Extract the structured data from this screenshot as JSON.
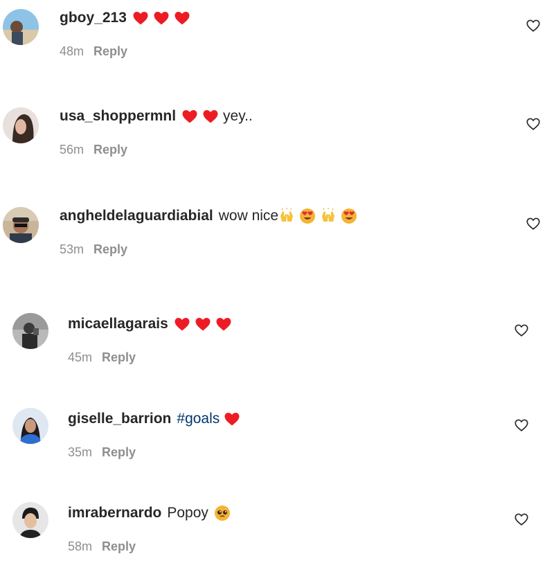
{
  "colors": {
    "heart": "#ed1c24",
    "text": "#262626",
    "muted": "#8e8e8e",
    "hashtag": "#00376b"
  },
  "comments": [
    {
      "username": "gboy_213",
      "text": "",
      "hashtag": "",
      "emojis": [
        "red-heart",
        "red-heart",
        "red-heart"
      ],
      "time": "48m",
      "reply": "Reply"
    },
    {
      "username": "usa_shoppermnl",
      "text": "yey..",
      "hashtag": "",
      "emojis": [
        "red-heart",
        "red-heart"
      ],
      "time": "56m",
      "reply": "Reply"
    },
    {
      "username": "angheldelaguardiabial",
      "text": "wow nice",
      "hashtag": "",
      "emojis": [
        "raising-hands",
        "heart-eyes",
        "raising-hands",
        "heart-eyes"
      ],
      "time": "53m",
      "reply": "Reply"
    },
    {
      "username": "micaellagarais",
      "text": "",
      "hashtag": "",
      "emojis": [
        "red-heart",
        "red-heart",
        "red-heart"
      ],
      "time": "45m",
      "reply": "Reply"
    },
    {
      "username": "giselle_barrion",
      "text": "",
      "hashtag": "#goals",
      "emojis": [
        "red-heart"
      ],
      "time": "35m",
      "reply": "Reply"
    },
    {
      "username": "imrabernardo",
      "text": "Popoy",
      "hashtag": "",
      "emojis": [
        "pleading-face"
      ],
      "time": "58m",
      "reply": "Reply"
    }
  ]
}
